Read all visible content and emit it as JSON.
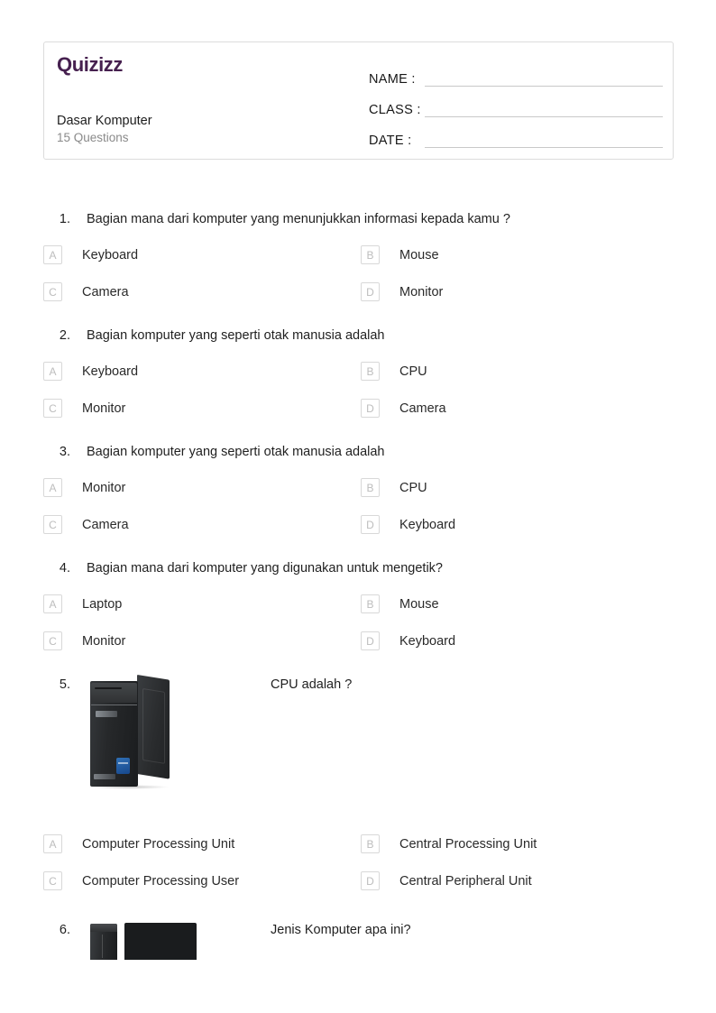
{
  "brand": {
    "logo_text": "Quizizz",
    "logo_color": "#46204f"
  },
  "header": {
    "quiz_title": "Dasar Komputer",
    "question_count_label": "15 Questions",
    "fields": [
      {
        "label": "NAME :",
        "value": ""
      },
      {
        "label": "CLASS :",
        "value": ""
      },
      {
        "label": "DATE  :",
        "value": ""
      }
    ]
  },
  "questions": [
    {
      "number": "1.",
      "text": "Bagian mana dari komputer yang menunjukkan informasi kepada kamu ?",
      "media": null,
      "options": [
        {
          "letter": "A",
          "text": "Keyboard"
        },
        {
          "letter": "B",
          "text": "Mouse"
        },
        {
          "letter": "C",
          "text": "Camera"
        },
        {
          "letter": "D",
          "text": "Monitor"
        }
      ]
    },
    {
      "number": "2.",
      "text": "Bagian komputer yang seperti otak manusia adalah",
      "media": null,
      "options": [
        {
          "letter": "A",
          "text": "Keyboard"
        },
        {
          "letter": "B",
          "text": "CPU"
        },
        {
          "letter": "C",
          "text": "Monitor"
        },
        {
          "letter": "D",
          "text": "Camera"
        }
      ]
    },
    {
      "number": "3.",
      "text": "Bagian komputer yang seperti otak manusia adalah",
      "media": null,
      "options": [
        {
          "letter": "A",
          "text": "Monitor"
        },
        {
          "letter": "B",
          "text": "CPU"
        },
        {
          "letter": "C",
          "text": "Camera"
        },
        {
          "letter": "D",
          "text": "Keyboard"
        }
      ]
    },
    {
      "number": "4.",
      "text": "Bagian mana dari komputer yang digunakan untuk mengetik?",
      "media": null,
      "options": [
        {
          "letter": "A",
          "text": "Laptop"
        },
        {
          "letter": "B",
          "text": "Mouse"
        },
        {
          "letter": "C",
          "text": "Monitor"
        },
        {
          "letter": "D",
          "text": "Keyboard"
        }
      ]
    },
    {
      "number": "5.",
      "text": "CPU adalah ?",
      "media": "desktop-tower-photo",
      "options": [
        {
          "letter": "A",
          "text": "Computer Processing Unit"
        },
        {
          "letter": "B",
          "text": "Central Processing Unit"
        },
        {
          "letter": "C",
          "text": "Computer Processing User"
        },
        {
          "letter": "D",
          "text": "Central Peripheral Unit"
        }
      ]
    },
    {
      "number": "6.",
      "text": "Jenis Komputer apa ini?",
      "media": "desktop-computer-set-photo",
      "options": []
    }
  ]
}
